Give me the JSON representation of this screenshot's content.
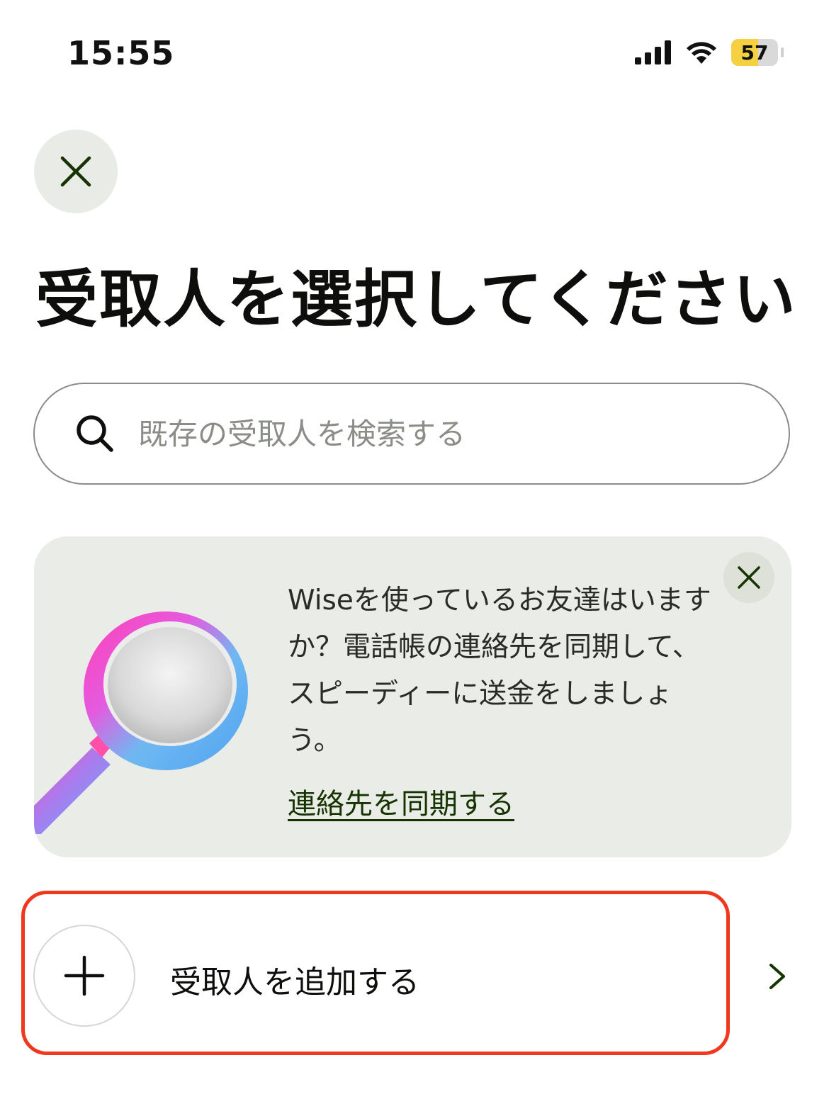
{
  "status_bar": {
    "time": "15:55",
    "battery_level": "57",
    "battery_fraction": 0.57
  },
  "header": {
    "close_icon": "close-icon",
    "title": "受取人を選択してください"
  },
  "search": {
    "placeholder": "既存の受取人を検索する",
    "icon": "search-icon"
  },
  "promo": {
    "text": "Wiseを使っているお友達はいますか？電話帳の連絡先を同期して、スピーディーに送金をしましょう。",
    "link_label": "連絡先を同期する",
    "illustration": "magnifying-glass-illustration",
    "close_icon": "close-icon"
  },
  "add_recipient": {
    "label": "受取人を追加する",
    "icon": "plus-icon",
    "chevron": "chevron-right-icon"
  },
  "colors": {
    "accent_dark_green": "#163300",
    "card_background": "#eaece7",
    "highlight_red": "#f0381e",
    "battery_yellow": "#f5d142"
  }
}
